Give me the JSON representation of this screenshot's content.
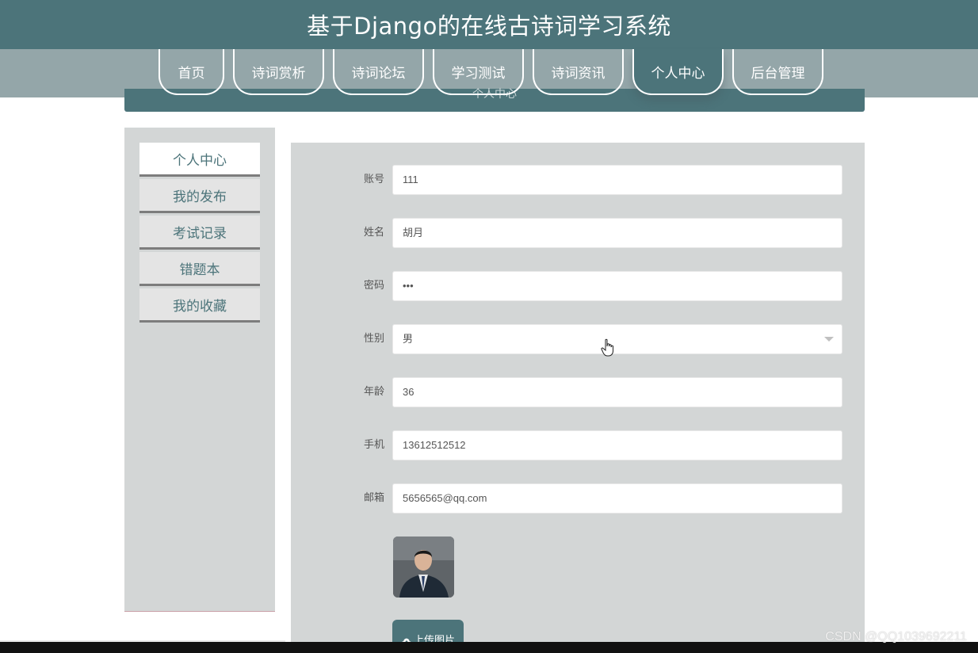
{
  "header": {
    "title": "基于Django的在线古诗词学习系统"
  },
  "nav": {
    "items": [
      {
        "label": "首页"
      },
      {
        "label": "诗词赏析"
      },
      {
        "label": "诗词论坛"
      },
      {
        "label": "学习测试"
      },
      {
        "label": "诗词资讯"
      },
      {
        "label": "个人中心",
        "active": true
      },
      {
        "label": "后台管理"
      }
    ]
  },
  "banner": {
    "title": "个人中心"
  },
  "sidebar": {
    "items": [
      {
        "label": "个人中心",
        "active": true
      },
      {
        "label": "我的发布"
      },
      {
        "label": "考试记录"
      },
      {
        "label": "错题本"
      },
      {
        "label": "我的收藏"
      }
    ]
  },
  "form": {
    "account_label": "账号",
    "account_value": "111",
    "name_label": "姓名",
    "name_value": "胡月",
    "password_label": "密码",
    "password_value": "•••",
    "gender_label": "性别",
    "gender_value": "男",
    "age_label": "年龄",
    "age_value": "36",
    "phone_label": "手机",
    "phone_value": "13612512512",
    "email_label": "邮箱",
    "email_value": "5656565@qq.com",
    "upload_label": "上传图片"
  },
  "watermark": "CSDN @QQ1039692211",
  "colors": {
    "primary": "#4c747a",
    "nav_strip": "#94a6a9",
    "panel": "#d3d6d6"
  },
  "icons": {
    "upload": "cloud-upload-icon",
    "cursor": "hand-pointer-icon",
    "select": "caret-down-icon"
  }
}
